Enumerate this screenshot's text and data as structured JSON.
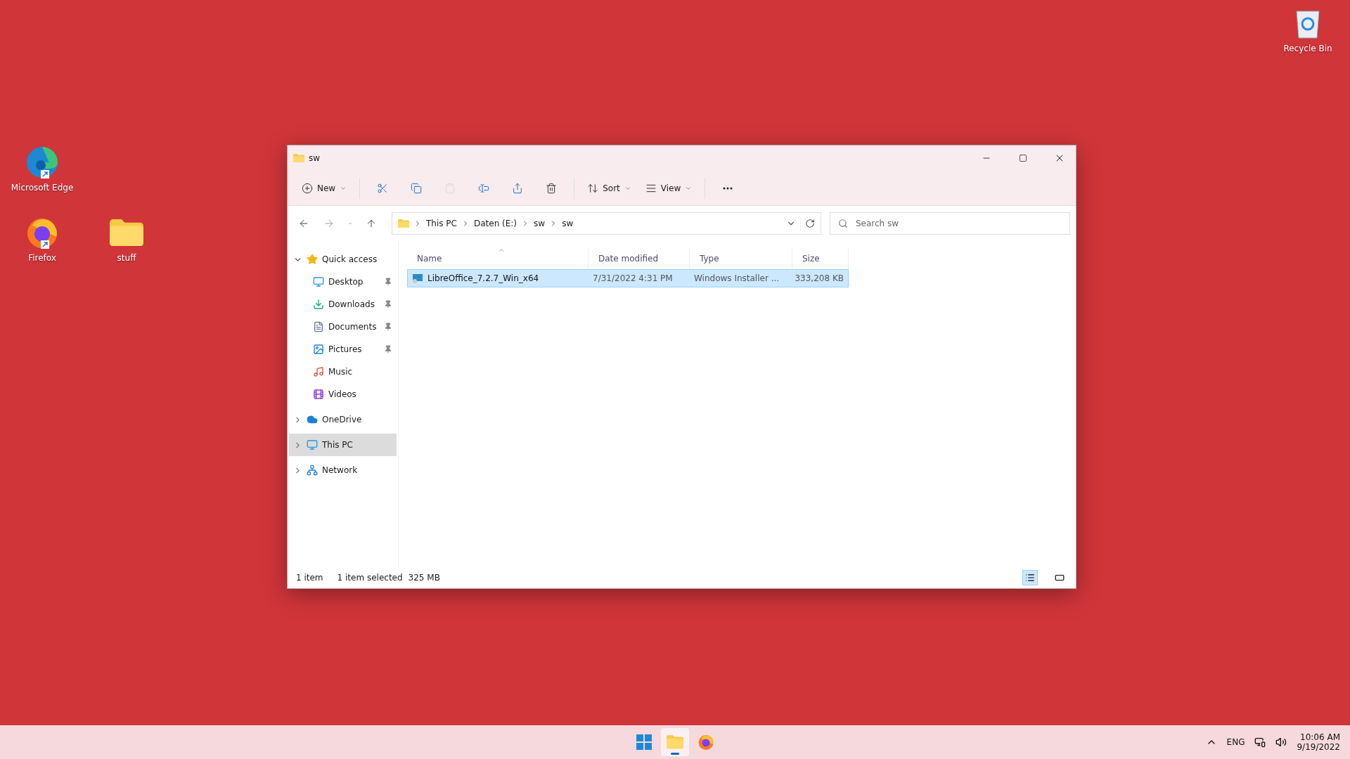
{
  "desktop_icons": [
    {
      "label": "Recycle Bin",
      "kind": "recycle",
      "shortcut": false
    },
    {
      "label": "Microsoft Edge",
      "kind": "edge",
      "shortcut": true
    },
    {
      "label": "Firefox",
      "kind": "firefox",
      "shortcut": true
    },
    {
      "label": "stuff",
      "kind": "folder",
      "shortcut": false
    }
  ],
  "window": {
    "title": "sw",
    "toolbar": [
      {
        "kind": "new",
        "label": "New",
        "disabled": false
      },
      {
        "kind": "separator"
      },
      {
        "kind": "cut",
        "disabled": false
      },
      {
        "kind": "copy",
        "disabled": false
      },
      {
        "kind": "paste",
        "disabled": true
      },
      {
        "kind": "rename",
        "disabled": false
      },
      {
        "kind": "share",
        "disabled": false
      },
      {
        "kind": "delete",
        "disabled": false
      },
      {
        "kind": "separator"
      },
      {
        "kind": "sort",
        "label": "Sort",
        "disabled": false
      },
      {
        "kind": "view",
        "label": "View",
        "disabled": false
      },
      {
        "kind": "separator"
      },
      {
        "kind": "more",
        "disabled": false
      }
    ],
    "breadcrumb": [
      "This PC",
      "Daten (E:)",
      "sw",
      "sw"
    ],
    "search": {
      "placeholder": "Search sw"
    },
    "sidebar": [
      {
        "label": "Quick access",
        "kind": "star",
        "expanded": true,
        "selected": false,
        "children": [
          {
            "label": "Desktop",
            "kind": "desktop",
            "pinned": true,
            "selected": false
          },
          {
            "label": "Downloads",
            "kind": "downloads",
            "pinned": true,
            "selected": false
          },
          {
            "label": "Documents",
            "kind": "documents",
            "pinned": true,
            "selected": false
          },
          {
            "label": "Pictures",
            "kind": "pictures",
            "pinned": true,
            "selected": false
          },
          {
            "label": "Music",
            "kind": "music",
            "pinned": false,
            "selected": false
          },
          {
            "label": "Videos",
            "kind": "videos",
            "pinned": false,
            "selected": false
          }
        ]
      },
      {
        "label": "OneDrive",
        "kind": "cloud",
        "expanded": false,
        "selected": false
      },
      {
        "label": "This PC",
        "kind": "pc",
        "expanded": false,
        "selected": true
      },
      {
        "label": "Network",
        "kind": "network",
        "expanded": false,
        "selected": false
      }
    ],
    "columns": [
      {
        "label": "Name",
        "sorted": true
      },
      {
        "label": "Date modified",
        "sorted": false
      },
      {
        "label": "Type",
        "sorted": false
      },
      {
        "label": "Size",
        "sorted": false
      }
    ],
    "rows": [
      {
        "name": "LibreOffice_7.2.7_Win_x64",
        "date": "7/31/2022 4:31 PM",
        "type": "Windows Installer ...",
        "size": "333,208 KB",
        "selected": true
      }
    ],
    "status_bar": {
      "count": "1 item",
      "selection": "1 item selected",
      "size": "325 MB",
      "views": [
        {
          "kind": "details",
          "selected": true
        },
        {
          "kind": "tiles",
          "selected": false
        }
      ]
    }
  },
  "taskbar": {
    "apps": [
      {
        "kind": "start",
        "active": false
      },
      {
        "kind": "explorer",
        "active": true
      },
      {
        "kind": "firefox",
        "active": false
      }
    ],
    "language": "ENG",
    "time": "10:06 AM",
    "date": "9/19/2022"
  }
}
